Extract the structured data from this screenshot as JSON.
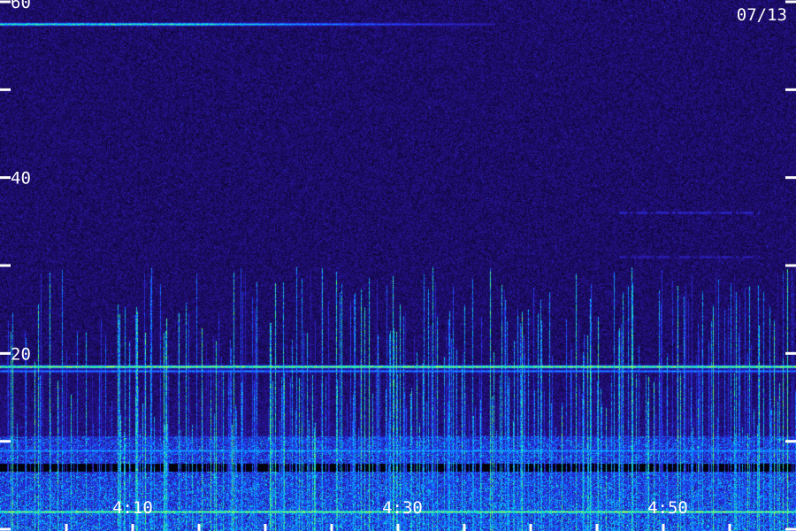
{
  "chart_data": {
    "type": "heatmap",
    "title": "",
    "date_label": "07/13",
    "xlabel": "",
    "ylabel": "",
    "ylim": [
      0,
      60
    ],
    "y_ticks": [
      0,
      10,
      20,
      30,
      40,
      50,
      60
    ],
    "y_tick_labels": [
      "20",
      "40",
      "60"
    ],
    "y_tick_label_values": [
      20,
      40,
      60
    ],
    "x_tick_labels": [
      "4:10",
      "4:30",
      "4:50"
    ],
    "colormap": [
      "#000000",
      "#1a0a5e",
      "#2b18a8",
      "#2040ff",
      "#00c0ff",
      "#40ff80",
      "#ffff00"
    ],
    "tick_color": "#ffffff",
    "label_color": "#ffffff",
    "horizontal_bands": [
      {
        "y": 57.5,
        "intensity": 0.75,
        "extent": "left two-thirds"
      },
      {
        "y": 36.0,
        "intensity": 0.25,
        "extent": "right side, bursts"
      },
      {
        "y": 31.0,
        "intensity": 0.2,
        "extent": "right side, bursts"
      },
      {
        "y": 18.5,
        "intensity": 0.9,
        "extent": "full width"
      },
      {
        "y": 18.0,
        "intensity": 0.5,
        "extent": "full width"
      },
      {
        "y": 9.0,
        "intensity": 0.55,
        "extent": "full width"
      },
      {
        "y": 2.0,
        "intensity": 0.9,
        "extent": "full width"
      }
    ],
    "dark_band": {
      "y": 7.0,
      "note": "no signal"
    }
  }
}
